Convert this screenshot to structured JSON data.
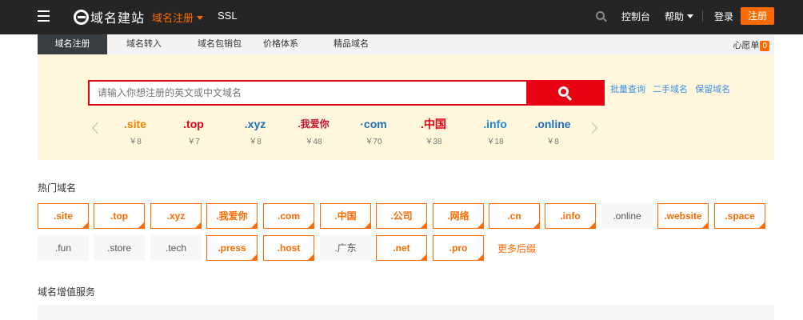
{
  "header": {
    "logo_text": "域名建站",
    "nav_register": "域名注册",
    "nav_ssl": "SSL",
    "console": "控制台",
    "help": "帮助",
    "login": "登录",
    "register": "注册"
  },
  "tabs": {
    "items": [
      {
        "label": "域名注册",
        "active": true
      },
      {
        "label": "域名转入",
        "active": false
      },
      {
        "label": "域名包销包",
        "active": false
      },
      {
        "label": "价格体系",
        "active": false
      },
      {
        "label": "精品域名",
        "active": false
      }
    ],
    "wishlist_label": "心愿单",
    "wishlist_count": "0"
  },
  "search": {
    "placeholder": "请输入你想注册的英文或中文域名",
    "quick_links": [
      "批量查询",
      "二手域名",
      "保留域名"
    ]
  },
  "promos": [
    {
      "name": ".site",
      "price": "￥8",
      "color": "#f08300"
    },
    {
      "name": ".top",
      "price": "￥7",
      "color": "#e60012"
    },
    {
      "name": ".xyz",
      "price": "￥8",
      "color": "#1e6fb9"
    },
    {
      "name": ".我爱你",
      "price": "￥48",
      "color": "#c8102e"
    },
    {
      "name": "·com",
      "price": "￥70",
      "color": "#1e6fb9"
    },
    {
      "name": ".中国",
      "price": "￥38",
      "color": "#e60012"
    },
    {
      "name": ".info",
      "price": "￥18",
      "color": "#1e88d1"
    },
    {
      "name": ".online",
      "price": "￥8",
      "color": "#1e6fb9"
    }
  ],
  "hot_domains": {
    "title": "热门域名",
    "row1": [
      {
        "name": ".site",
        "hot": true
      },
      {
        "name": ".top",
        "hot": true
      },
      {
        "name": ".xyz",
        "hot": true
      },
      {
        "name": ".我爱你",
        "hot": true
      },
      {
        "name": ".com",
        "hot": true
      },
      {
        "name": ".中国",
        "hot": true
      },
      {
        "name": ".公司",
        "hot": true
      },
      {
        "name": ".网络",
        "hot": true
      },
      {
        "name": ".cn",
        "hot": true
      },
      {
        "name": ".info",
        "hot": true
      },
      {
        "name": ".online",
        "hot": false
      },
      {
        "name": ".website",
        "hot": true
      },
      {
        "name": ".space",
        "hot": true
      }
    ],
    "row2": [
      {
        "name": ".fun",
        "hot": false
      },
      {
        "name": ".store",
        "hot": false
      },
      {
        "name": ".tech",
        "hot": false
      },
      {
        "name": ".press",
        "hot": true
      },
      {
        "name": ".host",
        "hot": true
      },
      {
        "name": ".广东",
        "hot": false
      },
      {
        "name": ".net",
        "hot": true
      },
      {
        "name": ".pro",
        "hot": true
      }
    ],
    "more_label": "更多后缀"
  },
  "value_services": {
    "title": "域名增值服务"
  },
  "colors": {
    "accent": "#ff6a00",
    "search_red": "#e60012",
    "topbar": "#252525",
    "panel_bg": "#fef7dc"
  }
}
